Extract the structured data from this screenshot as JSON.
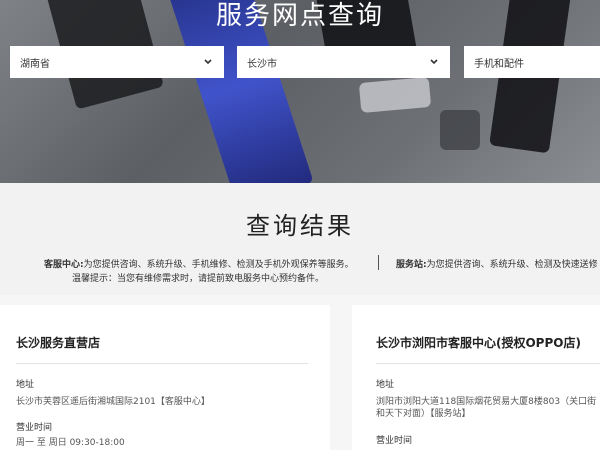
{
  "hero": {
    "title": "服务网点查询",
    "province": "湖南省",
    "city": "长沙市",
    "category": "手机和配件"
  },
  "results": {
    "title": "查询结果",
    "service_center_label": "客服中心:",
    "service_center_desc": "为您提供咨询、系统升级、手机维修、检测及手机外观保养等服务。",
    "service_station_label": "服务站:",
    "service_station_desc": "为您提供咨询、系统升级、检测及快速送修",
    "tip": "温馨提示：当您有维修需求时，请提前致电服务中心预约备件。"
  },
  "stores": [
    {
      "name": "长沙服务直营店",
      "address_label": "地址",
      "address": "长沙市芙蓉区遥后街湘城国际2101【客服中心】",
      "hours_label": "营业时间",
      "hours": "周一 至 周日 09:30-18:00"
    },
    {
      "name": "长沙市浏阳市客服中心(授权OPPO店)",
      "address_label": "地址",
      "address_line1": "浏阳市浏阳大道118国际烟花贸易大厦8楼803（关口街",
      "address_line2": "和天下对面）【服务站】",
      "hours_label": "营业时间"
    }
  ],
  "icons": {
    "dropdown": "chevron-down-icon"
  },
  "colors": {
    "hero_bg": "#6a6d72",
    "band_bg": "#f2f2f2"
  }
}
